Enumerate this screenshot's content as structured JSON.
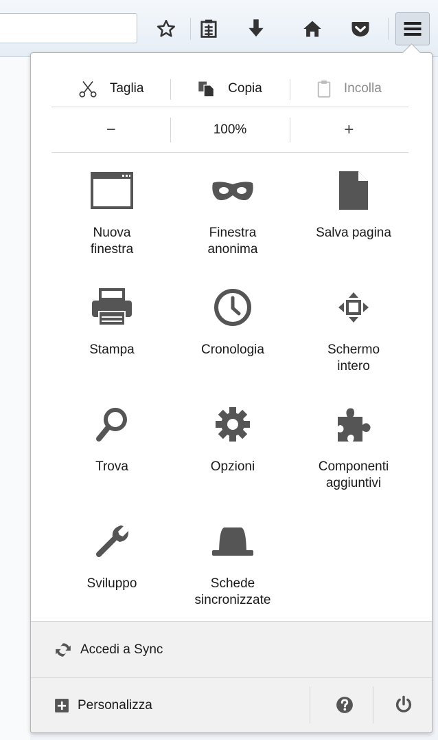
{
  "toolbar": {
    "icons": [
      "bookmark-star-icon",
      "reading-list-icon",
      "downloads-icon",
      "home-icon",
      "pocket-icon",
      "menu-icon"
    ]
  },
  "menu": {
    "edit": {
      "cut_label": "Taglia",
      "copy_label": "Copia",
      "paste_label": "Incolla"
    },
    "zoom": {
      "zoom_out": "−",
      "level": "100%",
      "zoom_in": "+"
    },
    "tiles": [
      {
        "line1": "Nuova",
        "line2": "finestra",
        "icon": "new-window-icon"
      },
      {
        "line1": "Finestra",
        "line2": "anonima",
        "icon": "private-mask-icon"
      },
      {
        "line1": "Salva pagina",
        "line2": "",
        "icon": "save-page-icon"
      },
      {
        "line1": "Stampa",
        "line2": "",
        "icon": "print-icon"
      },
      {
        "line1": "Cronologia",
        "line2": "",
        "icon": "history-clock-icon"
      },
      {
        "line1": "Schermo",
        "line2": "intero",
        "icon": "fullscreen-icon"
      },
      {
        "line1": "Trova",
        "line2": "",
        "icon": "find-icon"
      },
      {
        "line1": "Opzioni",
        "line2": "",
        "icon": "options-gear-icon"
      },
      {
        "line1": "Componenti",
        "line2": "aggiuntivi",
        "icon": "addons-puzzle-icon"
      },
      {
        "line1": "Sviluppo",
        "line2": "",
        "icon": "developer-wrench-icon"
      },
      {
        "line1": "Schede",
        "line2": "sincronizzate",
        "icon": "synced-tabs-icon"
      }
    ],
    "sync_label": "Accedi a Sync",
    "customize_label": "Personalizza"
  },
  "colors": {
    "icon_gray": "#555555",
    "disabled_gray": "#8a8a8a",
    "footer_bg": "#f1f1f1"
  }
}
